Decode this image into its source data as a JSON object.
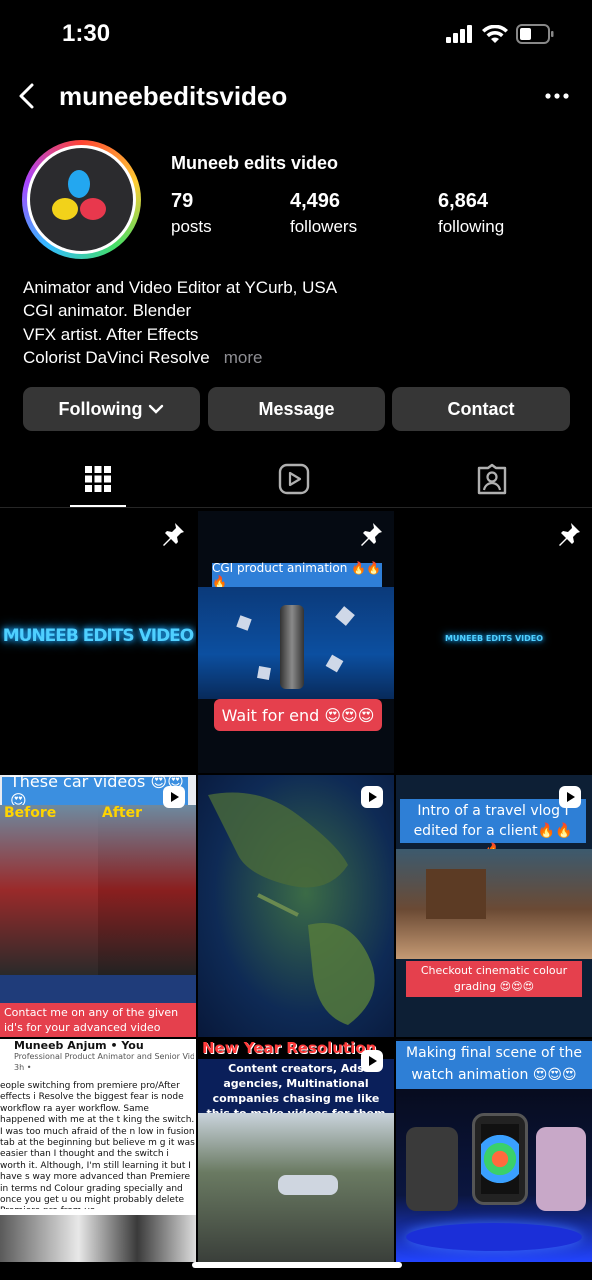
{
  "status": {
    "time": "1:30"
  },
  "header": {
    "username": "muneebeditsvideo"
  },
  "profile": {
    "display_name": "Muneeb edits video",
    "stats": [
      {
        "value": "79",
        "label": "posts"
      },
      {
        "value": "4,496",
        "label": "followers"
      },
      {
        "value": "6,864",
        "label": "following"
      }
    ],
    "bio": [
      "Animator and Video Editor at YCurb, USA",
      "CGI animator. Blender",
      "VFX artist. After Effects",
      "Colorist DaVinci Resolve"
    ],
    "more": "more"
  },
  "buttons": {
    "following": "Following",
    "message": "Message",
    "contact": "Contact"
  },
  "posts": {
    "p1": {
      "glow_text": "MUNEEB EDITS VIDEO"
    },
    "p2": {
      "top": "CGI product animation 🔥🔥🔥",
      "bottom": "Wait for end 😍😍😍"
    },
    "p3": {
      "glow_text": "MUNEEB EDITS VIDEO"
    },
    "p4": {
      "banner": "These car videos 😍😍😍",
      "before": "Before",
      "after": "After",
      "contact": "Contact me on any of the given id's for your advanced video editing and",
      "fb_name": "Muneeb Anjum • You",
      "fb_sub": "Professional Product Animator and Senior Video E",
      "fb_time": "3h •",
      "fb_text": "eople switching from premiere pro/After effects i Resolve the biggest fear is node workflow ra ayer workflow. Same happened with me at the t king the switch. I was too much afraid of the n low in fusion tab at the beginning but believe m g it was easier than I thought and the switch i worth it. Although, I'm still learning it but I have s way more advanced than Premiere in terms nd Colour grading specially and once you get u ou might probably delete Premiere pro from yo"
    },
    "p6": {
      "banner": "Intro of a travel vlog I edited for a client🔥🔥🔥",
      "tag": "Checkout cinematic colour grading 😍😍😍"
    },
    "p8": {
      "title": "New Year Resolution",
      "text": "Content creators, Ads agencies, Multinational companies chasing me like this to make videos for them 😎"
    },
    "p9": {
      "banner": "Making final scene of the watch animation 😍😍😍"
    }
  }
}
